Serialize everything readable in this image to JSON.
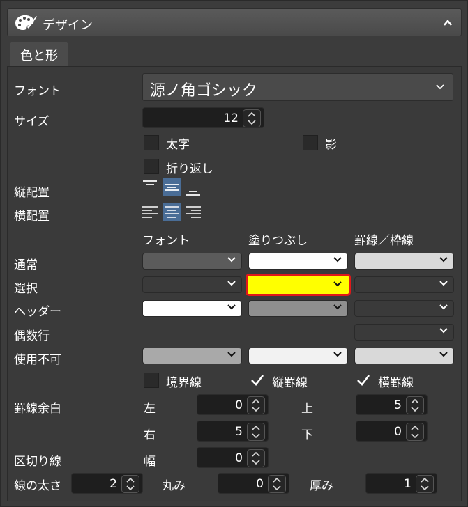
{
  "panel": {
    "title": "デザイン",
    "tab": "色と形"
  },
  "font": {
    "label": "フォント",
    "value": "源ノ角ゴシック"
  },
  "size": {
    "label": "サイズ",
    "value": "12"
  },
  "checkboxes": {
    "bold": {
      "label": "太字",
      "checked": false
    },
    "shadow": {
      "label": "影",
      "checked": false
    },
    "wrap": {
      "label": "折り返し",
      "checked": false
    },
    "border": {
      "label": "境界線",
      "checked": false
    },
    "vline": {
      "label": "縦罫線",
      "checked": true
    },
    "hline": {
      "label": "横罫線",
      "checked": true
    }
  },
  "valign": {
    "label": "縦配置",
    "options": [
      "top",
      "middle",
      "bottom"
    ],
    "selected": "middle"
  },
  "halign": {
    "label": "横配置",
    "options": [
      "left",
      "center",
      "right"
    ],
    "selected": "center"
  },
  "color_table": {
    "columns": [
      "フォント",
      "塗りつぶし",
      "罫線／枠線"
    ],
    "rows": [
      {
        "label": "通常",
        "colors": [
          "#5b5b5b",
          "#ffffff",
          "#d9d9d9"
        ]
      },
      {
        "label": "選択",
        "colors": [
          "#3a3a3a",
          "#ffff00",
          "#3a3a3a"
        ]
      },
      {
        "label": "ヘッダー",
        "colors": [
          "#ffffff",
          "#8f8f8f",
          "#3a3a3a"
        ]
      },
      {
        "label": "偶数行",
        "colors": [
          null,
          null,
          "#3a3a3a"
        ]
      },
      {
        "label": "使用不可",
        "colors": [
          "#a9a9a9",
          "#f2f2f2",
          "#d9d9d9"
        ]
      }
    ]
  },
  "margins": {
    "label": "罫線余白",
    "left": {
      "label": "左",
      "value": "0"
    },
    "top": {
      "label": "上",
      "value": "5"
    },
    "right": {
      "label": "右",
      "value": "5"
    },
    "bottom": {
      "label": "下",
      "value": "0"
    }
  },
  "divider": {
    "label": "区切り線",
    "width_label": "幅",
    "width_value": "0"
  },
  "line": {
    "label": "線の太さ",
    "value": "2",
    "round_label": "丸み",
    "round_value": "0",
    "thick_label": "厚み",
    "thick_value": "1"
  },
  "colors": {
    "highlight": "#e0191a",
    "accent": "#4a6d96"
  }
}
